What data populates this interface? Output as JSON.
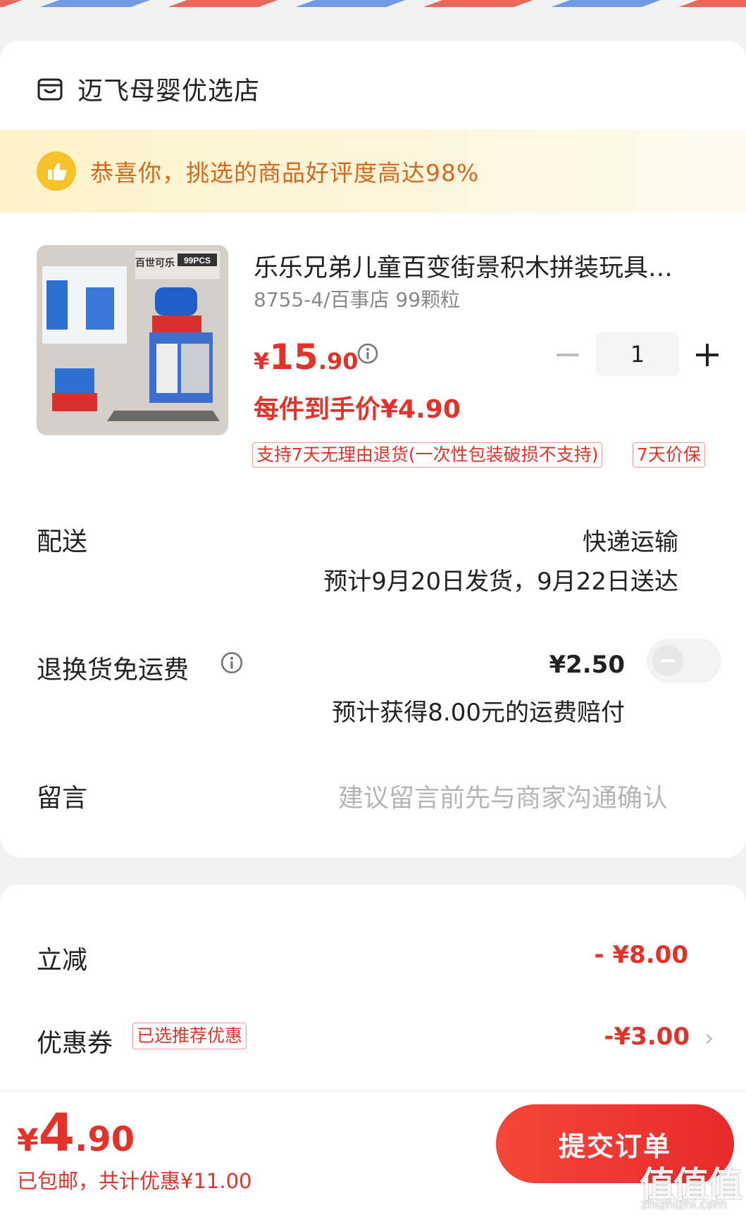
{
  "shop": {
    "name": "迈飞母婴优选店",
    "icon": "store-icon"
  },
  "banner": {
    "text": "恭喜你，挑选的商品好评度高达98%",
    "icon": "thumbs-up-icon"
  },
  "product": {
    "title": "乐乐兄弟儿童百变街景积木拼装玩具…",
    "spec": "8755-4/百事店 99颗粒",
    "price_symbol": "¥",
    "price_int": "15",
    "price_dec": ".90",
    "final_price": "每件到手价¥4.90",
    "quantity": "1",
    "tags": [
      "支持7天无理由退货(一次性包装破损不支持)",
      "7天价保"
    ],
    "image_text": {
      "brand": "百世可乐",
      "pcs": "99PCS"
    }
  },
  "delivery": {
    "label": "配送",
    "method": "快递运输",
    "estimate": "预计9月20日发货，9月22日送达"
  },
  "return_insurance": {
    "label": "退换货免运费",
    "price": "¥2.50",
    "note": "预计获得8.00元的运费赔付",
    "enabled": false
  },
  "message": {
    "label": "留言",
    "placeholder": "建议留言前先与商家沟通确认"
  },
  "discounts": {
    "instant_label": "立减",
    "instant_value": "- ¥8.00",
    "coupon_label": "优惠券",
    "coupon_badge": "已选推荐优惠",
    "coupon_value": "-¥3.00"
  },
  "footer": {
    "total_symbol": "¥",
    "total_int": "4",
    "total_dec": ".90",
    "summary": "已包邮，共计优惠¥11.00",
    "submit_label": "提交订单"
  },
  "watermark": {
    "text": "值值值",
    "domain": "zhizhizhi.com"
  },
  "colors": {
    "accent": "#e0332a",
    "banner_text": "#d2691e",
    "thumb": "#f7c12c"
  }
}
